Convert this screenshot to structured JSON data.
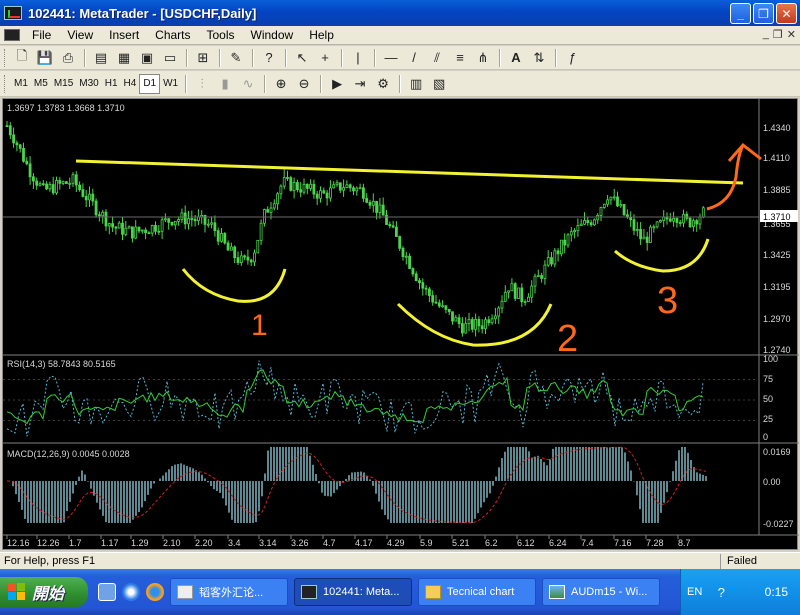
{
  "window": {
    "title": "102441: MetaTrader - [USDCHF,Daily]"
  },
  "menu": {
    "items": [
      {
        "label": "File"
      },
      {
        "label": "View"
      },
      {
        "label": "Insert"
      },
      {
        "label": "Charts"
      },
      {
        "label": "Tools"
      },
      {
        "label": "Window"
      },
      {
        "label": "Help"
      }
    ]
  },
  "timeframes": [
    "M1",
    "M5",
    "M15",
    "M30",
    "H1",
    "H4",
    "D1",
    "W1"
  ],
  "active_timeframe": "D1",
  "chart": {
    "ohlc_header": "1.3697 1.3783 1.3668 1.3710",
    "price_axis": [
      "1.4340",
      "1.4110",
      "1.3885",
      "1.3655",
      "1.3425",
      "1.3195",
      "1.2970",
      "1.2740"
    ],
    "current_price": "1.3710",
    "date_axis": [
      "12.16",
      "12.26",
      "1.7",
      "1.17",
      "1.29",
      "2.10",
      "2.20",
      "3.4",
      "3.14",
      "3.26",
      "4.7",
      "4.17",
      "4.29",
      "5.9",
      "5.21",
      "6.2",
      "6.12",
      "6.24",
      "7.4",
      "7.16",
      "7.28",
      "8.7"
    ],
    "annotations": [
      "1",
      "2",
      "3"
    ],
    "rsi": {
      "label": "RSI(14,3)  58.7843  80.5165",
      "axis": [
        "100",
        "75",
        "50",
        "25",
        "0"
      ]
    },
    "macd": {
      "label": "MACD(12,26,9)  0.0045  0.0028",
      "axis": [
        "0.0169",
        "0.00",
        "-0.0227"
      ]
    },
    "colors": {
      "candles": "#4cd44c",
      "neckline": "#f2f230",
      "annotation": "#ff6a1a",
      "rsi_main": "#32cd32",
      "rsi_signal": "#58b8d8",
      "macd_hist": "#9fe3f2",
      "macd_signal": "#d02020"
    }
  },
  "status": {
    "help": "For Help, press F1",
    "connection": "Failed"
  },
  "taskbar": {
    "start_label": "開始",
    "tasks": [
      {
        "label": "韬客外汇论..."
      },
      {
        "label": "102441: Meta..."
      },
      {
        "label": "Tecnical chart"
      },
      {
        "label": "AUDm15 - Wi..."
      }
    ],
    "lang": "EN",
    "clock": "0:15"
  }
}
